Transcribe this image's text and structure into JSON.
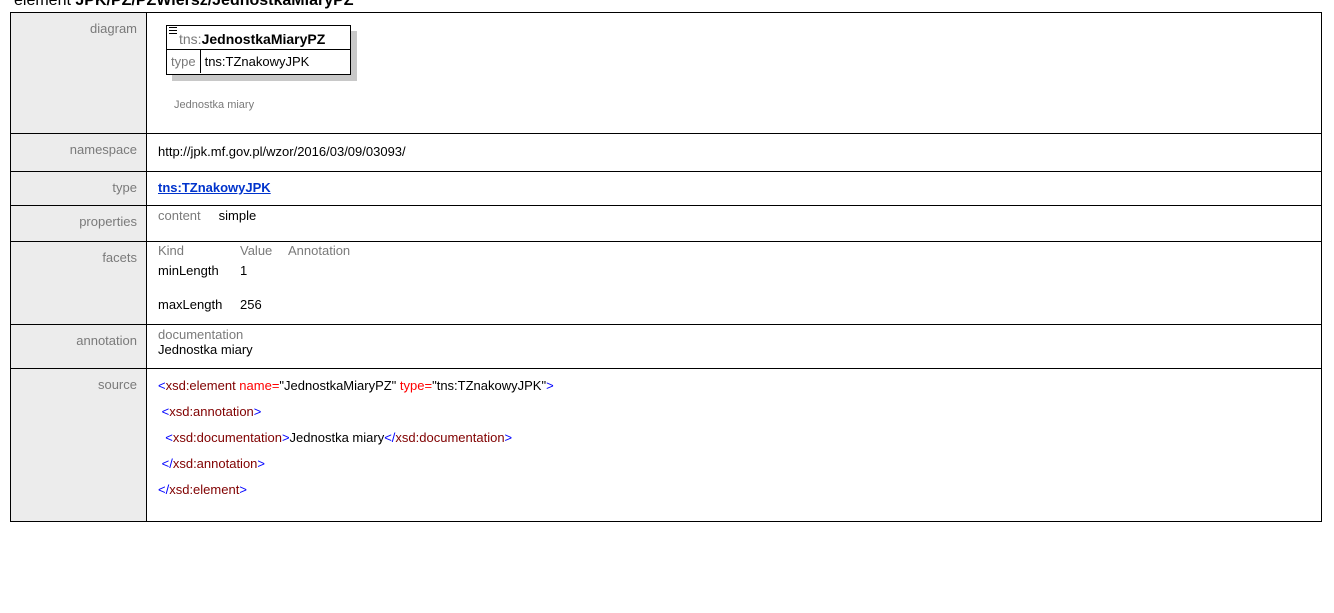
{
  "page": {
    "title_prefix": "element ",
    "title_path": "JPK/PZ/PZWiersz/JednostkaMiaryPZ"
  },
  "rows": {
    "diagram_label": "diagram",
    "namespace_label": "namespace",
    "type_label": "type",
    "properties_label": "properties",
    "facets_label": "facets",
    "annotation_label": "annotation",
    "source_label": "source"
  },
  "diagram": {
    "prefix": "tns:",
    "name": "JednostkaMiaryPZ",
    "type_key": "type",
    "type_value": "tns:TZnakowyJPK",
    "doc": "Jednostka miary"
  },
  "namespace": "http://jpk.mf.gov.pl/wzor/2016/03/09/03093/",
  "type": "tns:TZnakowyJPK",
  "properties": {
    "key": "content",
    "value": "simple"
  },
  "facets": {
    "headers": [
      "Kind",
      "Value",
      "Annotation"
    ],
    "rows": [
      {
        "kind": "minLength",
        "value": "1",
        "annotation": ""
      },
      {
        "kind": "maxLength",
        "value": "256",
        "annotation": ""
      }
    ]
  },
  "annotation": {
    "heading": "documentation",
    "text": "Jednostka miary"
  },
  "source": {
    "l1_open": "<",
    "l1_tag": "xsd:element",
    "l1_attr1": " name=",
    "l1_val1": "\"JednostkaMiaryPZ\"",
    "l1_attr2": " type=",
    "l1_val2": "\"tns:TZnakowyJPK\"",
    "l1_close": ">",
    "l2_tag": "xsd:annotation",
    "l3_tag": "xsd:documentation",
    "l3_text": "Jednostka miary",
    "l4_tag": "xsd:annotation",
    "l5_tag": "xsd:element"
  }
}
